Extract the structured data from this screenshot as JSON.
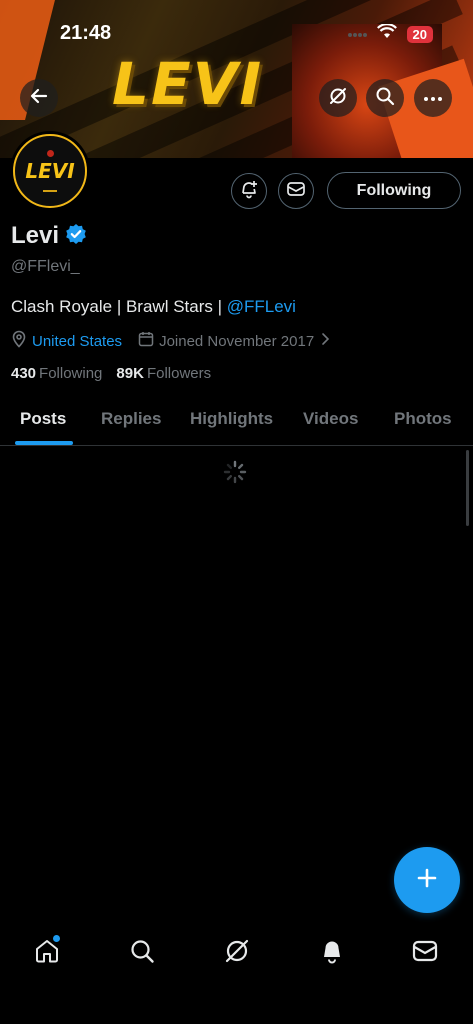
{
  "status_bar": {
    "time": "21:48",
    "battery": "20"
  },
  "banner": {
    "logo_text": "LEVI"
  },
  "avatar": {
    "text": "LEVI"
  },
  "actions": {
    "following_label": "Following"
  },
  "profile": {
    "display_name": "Levi",
    "handle": "@FFlevi_",
    "bio_text": "Clash Royale | Brawl Stars | ",
    "bio_link": "@FFLevi",
    "location": "United States",
    "joined": "Joined November 2017",
    "following_count": "430",
    "following_label": "Following",
    "followers_count": "89K",
    "followers_label": "Followers"
  },
  "tabs": [
    {
      "label": "Posts",
      "active": true
    },
    {
      "label": "Replies",
      "active": false
    },
    {
      "label": "Highlights",
      "active": false
    },
    {
      "label": "Videos",
      "active": false
    },
    {
      "label": "Photos",
      "active": false
    }
  ],
  "colors": {
    "accent": "#1d9bf0",
    "background": "#000000",
    "muted_text": "#71767b",
    "banner_logo": "#f7c318"
  },
  "icons": {
    "back": "arrow-left-icon",
    "grok": "grok-icon",
    "search": "search-icon",
    "more": "more-icon",
    "notify": "bell-plus-icon",
    "message": "envelope-icon",
    "verified": "verified-badge-icon",
    "location": "location-pin-icon",
    "calendar": "calendar-icon",
    "compose": "plus-icon",
    "nav": [
      "home-icon",
      "search-icon",
      "grok-icon",
      "bell-icon",
      "envelope-icon"
    ]
  }
}
